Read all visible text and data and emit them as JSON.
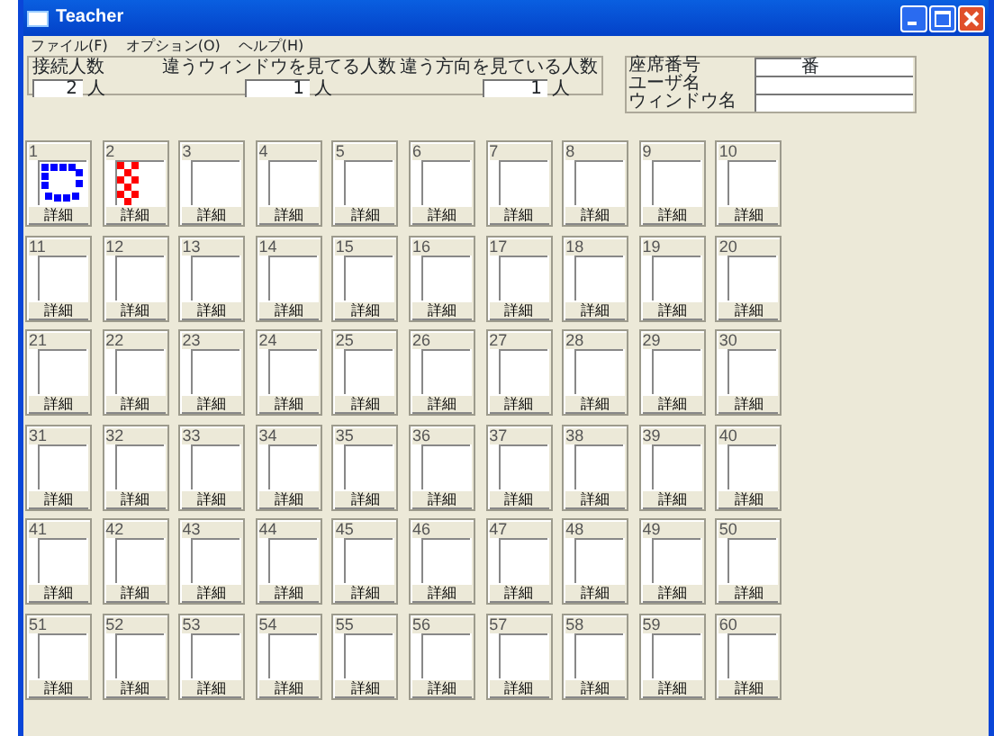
{
  "window": {
    "title": "Teacher"
  },
  "menu": [
    "ファイル(F)",
    "オプション(O)",
    "ヘルプ(H)"
  ],
  "stats": [
    {
      "label": "接続人数",
      "value": "2",
      "unit": "人"
    },
    {
      "label": "違うウィンドウを見てる人数",
      "value": "1",
      "unit": "人"
    },
    {
      "label": "違う方向を見ている人数",
      "value": "1",
      "unit": "人"
    }
  ],
  "info": [
    {
      "label": "座席番号",
      "unit": "番"
    },
    {
      "label": "ユーザ名"
    },
    {
      "label": "ウィンドウ名"
    }
  ],
  "seats": [
    {
      "number": "1",
      "kind": "dots",
      "color": "#0000ff",
      "button": "詳細"
    },
    {
      "number": "2",
      "kind": "checker",
      "color": "#ff0000",
      "button": "詳細"
    },
    {
      "number": "3",
      "button": "詳細"
    },
    {
      "number": "4",
      "button": "詳細"
    },
    {
      "number": "5",
      "button": "詳細"
    },
    {
      "number": "6",
      "button": "詳細"
    },
    {
      "number": "7",
      "button": "詳細"
    },
    {
      "number": "8",
      "button": "詳細"
    },
    {
      "number": "9",
      "button": "詳細"
    },
    {
      "number": "10",
      "button": "詳細"
    },
    {
      "number": "11",
      "button": "詳細"
    },
    {
      "number": "12",
      "button": "詳細"
    },
    {
      "number": "13",
      "button": "詳細"
    },
    {
      "number": "14",
      "button": "詳細"
    },
    {
      "number": "15",
      "button": "詳細"
    },
    {
      "number": "16",
      "button": "詳細"
    },
    {
      "number": "17",
      "button": "詳細"
    },
    {
      "number": "18",
      "button": "詳細"
    },
    {
      "number": "19",
      "button": "詳細"
    },
    {
      "number": "20",
      "button": "詳細"
    },
    {
      "number": "21",
      "button": "詳細"
    },
    {
      "number": "22",
      "button": "詳細"
    },
    {
      "number": "23",
      "button": "詳細"
    },
    {
      "number": "24",
      "button": "詳細"
    },
    {
      "number": "25",
      "button": "詳細"
    },
    {
      "number": "26",
      "button": "詳細"
    },
    {
      "number": "27",
      "button": "詳細"
    },
    {
      "number": "28",
      "button": "詳細"
    },
    {
      "number": "29",
      "button": "詳細"
    },
    {
      "number": "30",
      "button": "詳細"
    },
    {
      "number": "31",
      "button": "詳細"
    },
    {
      "number": "32",
      "button": "詳細"
    },
    {
      "number": "33",
      "button": "詳細"
    },
    {
      "number": "34",
      "button": "詳細"
    },
    {
      "number": "35",
      "button": "詳細"
    },
    {
      "number": "36",
      "button": "詳細"
    },
    {
      "number": "37",
      "button": "詳細"
    },
    {
      "number": "38",
      "button": "詳細"
    },
    {
      "number": "39",
      "button": "詳細"
    },
    {
      "number": "40",
      "button": "詳細"
    },
    {
      "number": "41",
      "button": "詳細"
    },
    {
      "number": "42",
      "button": "詳細"
    },
    {
      "number": "43",
      "button": "詳細"
    },
    {
      "number": "44",
      "button": "詳細"
    },
    {
      "number": "45",
      "button": "詳細"
    },
    {
      "number": "46",
      "button": "詳細"
    },
    {
      "number": "47",
      "button": "詳細"
    },
    {
      "number": "48",
      "button": "詳細"
    },
    {
      "number": "49",
      "button": "詳細"
    },
    {
      "number": "50",
      "button": "詳細"
    },
    {
      "number": "51",
      "button": "詳細"
    },
    {
      "number": "52",
      "button": "詳細"
    },
    {
      "number": "53",
      "button": "詳細"
    },
    {
      "number": "54",
      "button": "詳細"
    },
    {
      "number": "55",
      "button": "詳細"
    },
    {
      "number": "56",
      "button": "詳細"
    },
    {
      "number": "57",
      "button": "詳細"
    },
    {
      "number": "58",
      "button": "詳細"
    },
    {
      "number": "59",
      "button": "詳細"
    },
    {
      "number": "60",
      "button": "詳細"
    }
  ]
}
